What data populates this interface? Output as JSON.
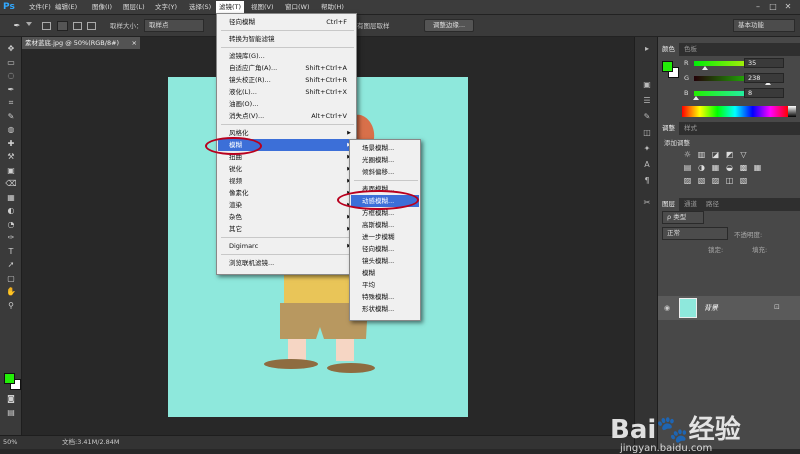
{
  "app": {
    "logo": "Ps"
  },
  "menubar": {
    "items": [
      {
        "label": "文件(F)",
        "active": false
      },
      {
        "label": "编辑(E)",
        "active": false
      },
      {
        "label": "图像(I)",
        "active": false
      },
      {
        "label": "图层(L)",
        "active": false
      },
      {
        "label": "文字(Y)",
        "active": false
      },
      {
        "label": "选择(S)",
        "active": false
      },
      {
        "label": "滤镜(T)",
        "active": true
      },
      {
        "label": "视图(V)",
        "active": false
      },
      {
        "label": "窗口(W)",
        "active": false
      },
      {
        "label": "帮助(H)",
        "active": false
      }
    ],
    "window_buttons": [
      "–",
      "□",
      "✕"
    ]
  },
  "options_bar": {
    "sample_size_label": "取样大小：",
    "sample_size_value": "取样点",
    "sample_all_layers": "对所有图层取样",
    "refine_edge_button": "调整边缘...",
    "workspace_value": "基本功能"
  },
  "document": {
    "tab_title": "素材蓝底.jpg @ 50%(RGB/8#)",
    "tab_close": "×"
  },
  "status": {
    "zoom": "50%",
    "doc_info": "文档:3.41M/2.84M"
  },
  "filter_menu": {
    "items": [
      {
        "label": "径向模糊",
        "shortcut": "Ctrl+F"
      },
      {
        "sep": true
      },
      {
        "label": "转换为智能滤镜"
      },
      {
        "sep": true
      },
      {
        "label": "滤镜库(G)..."
      },
      {
        "label": "自适应广角(A)...",
        "shortcut": "Shift+Ctrl+A"
      },
      {
        "label": "镜头校正(R)...",
        "shortcut": "Shift+Ctrl+R"
      },
      {
        "label": "液化(L)...",
        "shortcut": "Shift+Ctrl+X"
      },
      {
        "label": "油画(O)..."
      },
      {
        "label": "消失点(V)...",
        "shortcut": "Alt+Ctrl+V"
      },
      {
        "sep": true
      },
      {
        "label": "风格化",
        "sub": true
      },
      {
        "label": "模糊",
        "sub": true,
        "highlight": true
      },
      {
        "label": "扭曲",
        "sub": true
      },
      {
        "label": "锐化",
        "sub": true
      },
      {
        "label": "视频",
        "sub": true
      },
      {
        "label": "像素化",
        "sub": true
      },
      {
        "label": "渲染",
        "sub": true
      },
      {
        "label": "杂色",
        "sub": true
      },
      {
        "label": "其它",
        "sub": true
      },
      {
        "sep": true
      },
      {
        "label": "Digimarc",
        "sub": true
      },
      {
        "sep": true
      },
      {
        "label": "浏览联机滤镜..."
      }
    ]
  },
  "blur_submenu": {
    "items": [
      {
        "label": "场景模糊..."
      },
      {
        "label": "光圈模糊..."
      },
      {
        "label": "倾斜偏移..."
      },
      {
        "sep": true
      },
      {
        "label": "表面模糊..."
      },
      {
        "label": "动感模糊...",
        "highlight": true
      },
      {
        "label": "方框模糊..."
      },
      {
        "label": "高斯模糊..."
      },
      {
        "label": "进一步模糊"
      },
      {
        "label": "径向模糊..."
      },
      {
        "label": "镜头模糊..."
      },
      {
        "label": "模糊"
      },
      {
        "label": "平均"
      },
      {
        "label": "特殊模糊..."
      },
      {
        "label": "形状模糊..."
      }
    ]
  },
  "color_panel": {
    "tabs": [
      "颜色",
      "色板"
    ],
    "channels": [
      {
        "label": "R",
        "value": "35",
        "position": 0.14
      },
      {
        "label": "G",
        "value": "238",
        "position": 0.93
      },
      {
        "label": "B",
        "value": "8",
        "position": 0.03
      }
    ],
    "foreground": "#23ee08",
    "background": "#ffffff"
  },
  "adjust_panel": {
    "tabs": [
      "调整",
      "样式"
    ],
    "title": "添加调整"
  },
  "layers_panel": {
    "tabs": [
      "图层",
      "通道",
      "路径"
    ],
    "filter_value": "ρ 类型",
    "blend_mode": "正常",
    "opacity_label": "不透明度:",
    "lock_label": "锁定:",
    "fill_label": "填充:",
    "layer_name": "背景"
  },
  "watermark": {
    "brand": "Bai",
    "brand_suffix": "经验",
    "url": "jingyan.baidu.com"
  },
  "colors": {
    "canvas": "#8ee8dc",
    "highlight": "#3c6fd8",
    "annotation": "#b8001e"
  }
}
